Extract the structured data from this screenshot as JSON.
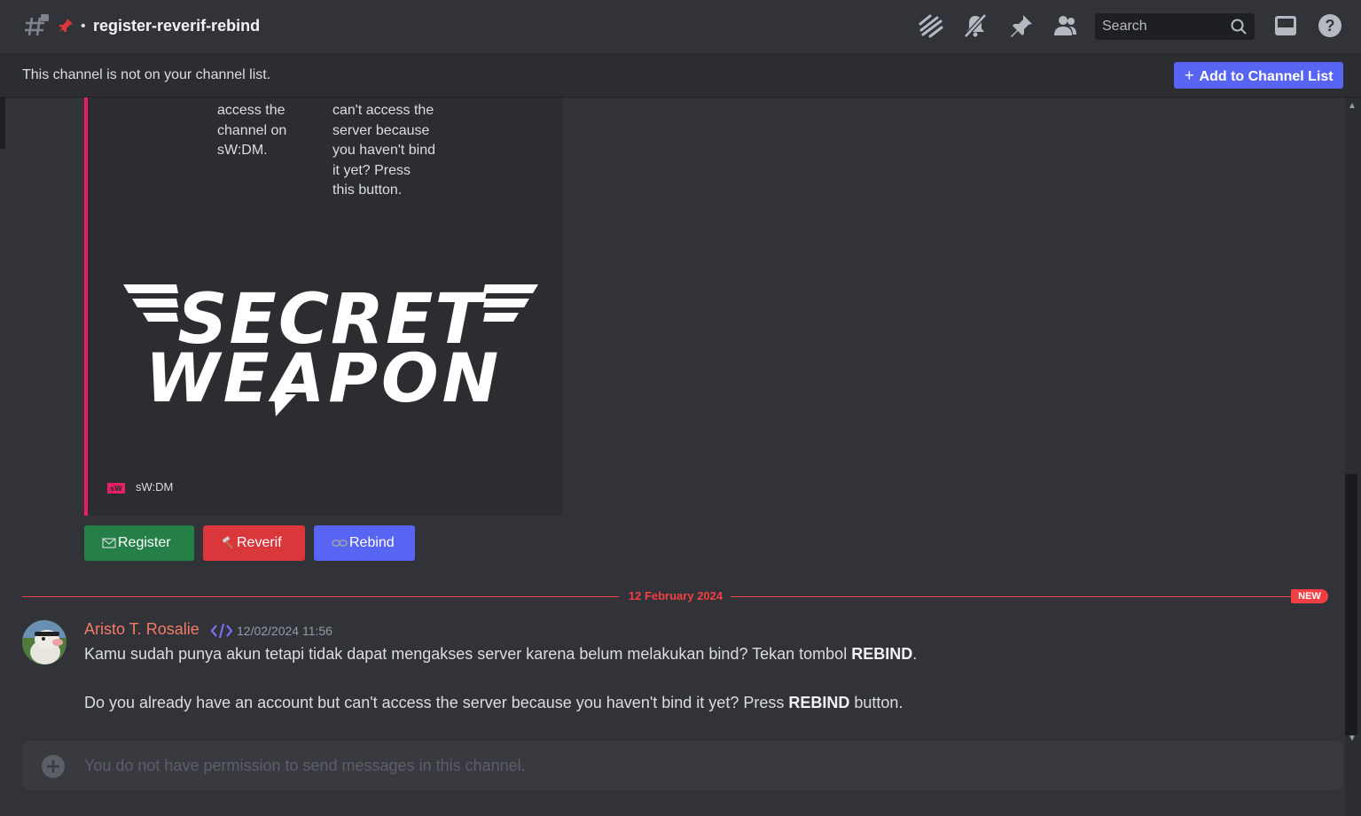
{
  "header": {
    "channel_name": "register-reverif-rebind",
    "separator": "•",
    "icons": [
      "threads-icon",
      "mute-bell-icon",
      "pin-icon",
      "members-icon",
      "inbox-icon",
      "help-icon"
    ],
    "search_placeholder": "Search"
  },
  "notice": {
    "text": "This channel is not on your channel list.",
    "button_label": "Add to Channel List",
    "button_icon": "+"
  },
  "embed": {
    "col1_text": [
      "access the",
      "channel on",
      "sW:DM."
    ],
    "col2_text": [
      "can't access the",
      "server because",
      "you haven't bind",
      "it yet? Press",
      "this button."
    ],
    "logo_lines": [
      "SECRET",
      "WEAPON"
    ],
    "footer_text": "sW:DM",
    "accent": "#e91e63"
  },
  "buttons": {
    "register": {
      "label": "Register",
      "icon": "envelope-icon",
      "color": "#248046"
    },
    "reverif": {
      "label": "Reverif",
      "icon": "hammer-icon",
      "color": "#da373c"
    },
    "rebind": {
      "label": "Rebind",
      "icon": "link-icon",
      "color": "#5865f2"
    }
  },
  "divider": {
    "date": "12 February 2024",
    "badge": "NEW"
  },
  "message": {
    "author": "Aristo T. Rosalie",
    "author_color": "#f47b67",
    "timestamp": "12/02/2024 11:56",
    "line1_pre": "Kamu sudah punya akun tetapi tidak dapat mengakses server karena belum melakukan bind? Tekan tombol ",
    "line1_bold": "REBIND",
    "line1_post": ".",
    "line2_pre": "Do you already have an account but can't access the server because you haven't bind it yet? Press ",
    "line2_bold": "REBIND",
    "line2_post": " button."
  },
  "composer": {
    "placeholder": "You do not have permission to send messages in this channel."
  }
}
